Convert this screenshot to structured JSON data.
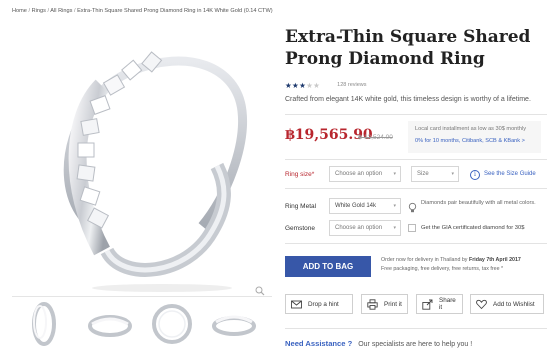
{
  "breadcrumb": {
    "home": "Home",
    "rings": "Rings",
    "all_rings": "All Rings",
    "current": "Extra-Thin Square Shared Prong Diamond Ring in 14K White Gold (0.14 CTW)",
    "separator": "/"
  },
  "product": {
    "title_line1": "Extra-Thin Square Shared",
    "title_line2": "Prong Diamond Ring",
    "rating": 3,
    "rating_max": 5,
    "reviews": "128 reviews",
    "description": "Crafted from elegant 14K white gold, this timeless design is worthy of a lifetime."
  },
  "pricing": {
    "price": "฿19,565.90",
    "old_price": "฿ 12,524.00",
    "installment_line1": "Local card installment as low as 30$ monthly",
    "installment_line2": "0% for 10 months, Citibank, SCB & KBank >"
  },
  "options": {
    "ring_size_label": "Ring size*",
    "ring_size_placeholder": "Choose an option",
    "size_placeholder": "Size",
    "size_guide": "See the Size Guide",
    "ring_metal_label": "Ring Metal",
    "ring_metal_value": "White Gold 14k",
    "metal_note": "Diamonds pair beautifully with all metal colors.",
    "gemstone_label": "Gemstone",
    "gemstone_placeholder": "Choose an option",
    "gia_label": "Get the GIA certificated diamond for 30$"
  },
  "cart": {
    "add_to_bag": "ADD TO BAG",
    "delivery_prefix": "Order now for delivery in Thailand by",
    "delivery_date": "Friday 7th April 2017",
    "delivery_line2": "Free packaging, free delivery, free returns, tax free *"
  },
  "actions": {
    "drop_hint": "Drop a hint",
    "print": "Print it",
    "share": "Share it",
    "wishlist": "Add to Wishlist"
  },
  "assistance": {
    "title": "Need Assistance ?",
    "subtitle": "Our specialists are here to help you !"
  },
  "colors": {
    "accent_blue": "#3757a8",
    "price_red": "#b8262e",
    "link_blue": "#3a62c0"
  }
}
